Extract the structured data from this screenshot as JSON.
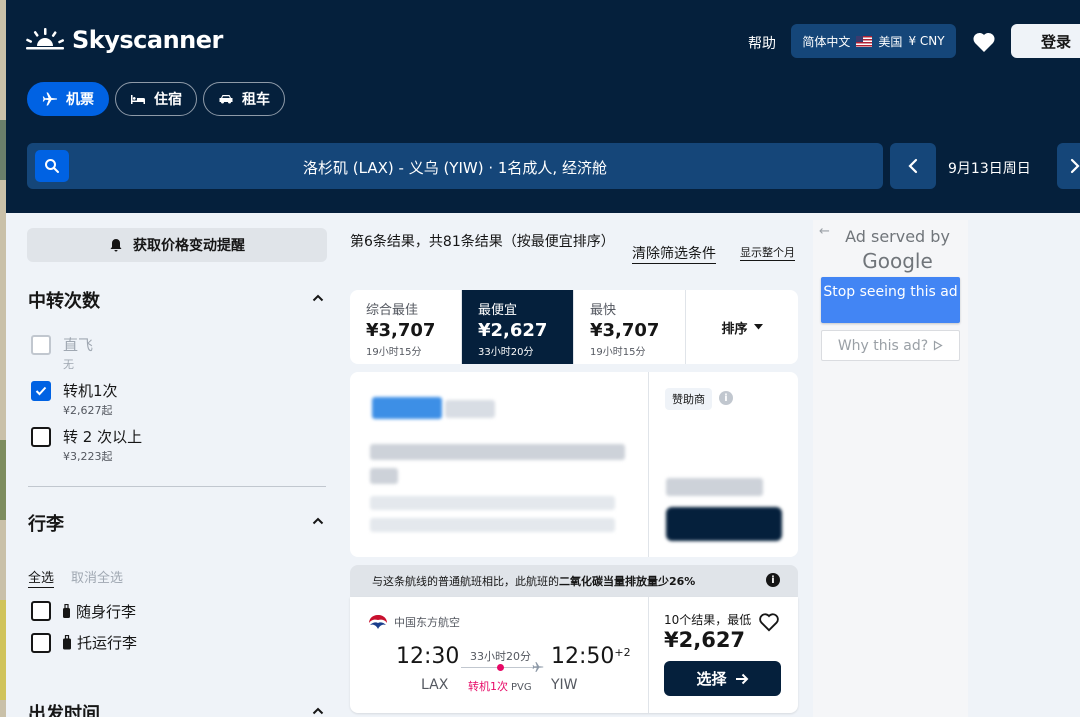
{
  "brand": {
    "name": "Skyscanner"
  },
  "header": {
    "help": "帮助",
    "locale": {
      "language": "简体中文",
      "country": "美国",
      "currency": "¥ CNY"
    },
    "login": "登录"
  },
  "tabs": [
    {
      "label": "机票",
      "active": true
    },
    {
      "label": "住宿",
      "active": false
    },
    {
      "label": "租车",
      "active": false
    }
  ],
  "search": {
    "summary": "洛杉矶 (LAX) - 义乌 (YIW)  ·  1名成人, 经济舱",
    "date": "9月13日周日"
  },
  "sidebar": {
    "price_alert": "获取价格变动提醒",
    "stops": {
      "title": "中转次数",
      "options": [
        {
          "label": "直飞",
          "sub": "无",
          "checked": false,
          "disabled": true
        },
        {
          "label": "转机1次",
          "sub": "¥2,627起",
          "checked": true,
          "disabled": false
        },
        {
          "label": "转 2 次以上",
          "sub": "¥3,223起",
          "checked": false,
          "disabled": false
        }
      ]
    },
    "baggage": {
      "title": "行李",
      "select_all": "全选",
      "deselect_all": "取消全选",
      "options": [
        {
          "label": "随身行李",
          "checked": false
        },
        {
          "label": "托运行李",
          "checked": false
        }
      ]
    },
    "departure": {
      "title": "出发时间"
    }
  },
  "results": {
    "count_text": "第6条结果，共81条结果（按最便宜排序）",
    "clear_filters": "清除筛选条件",
    "show_month": "显示整个月",
    "sort_tabs": [
      {
        "label": "综合最佳",
        "price": "¥3,707",
        "duration": "19小时15分",
        "active": false
      },
      {
        "label": "最便宜",
        "price": "¥2,627",
        "duration": "33小时20分",
        "active": true
      },
      {
        "label": "最快",
        "price": "¥3,707",
        "duration": "19小时15分",
        "active": false
      }
    ],
    "sort_menu": "排序",
    "sponsored": {
      "badge": "赞助商"
    },
    "eco_note": {
      "prefix": "与这条航线的普通航班相比，此航班的",
      "highlight": "二氧化碳当量排放量少26%"
    },
    "flight": {
      "airline": "中国东方航空",
      "depart_time": "12:30",
      "depart_airport": "LAX",
      "duration": "33小时20分",
      "stops": "转机1次",
      "stop_airport": "PVG",
      "arrive_time": "12:50",
      "arrive_offset": "+2",
      "arrive_airport": "YIW",
      "deals": "10个结果，最低",
      "price": "¥2,627",
      "select": "选择"
    }
  },
  "google_ad": {
    "served_by": "Ad served by",
    "google": "Google",
    "stop_seeing": "Stop seeing this ad",
    "why": "Why this ad?"
  },
  "colors": {
    "header_bg": "#05203c",
    "accent": "#0062e3",
    "stop_pink": "#e70866"
  }
}
